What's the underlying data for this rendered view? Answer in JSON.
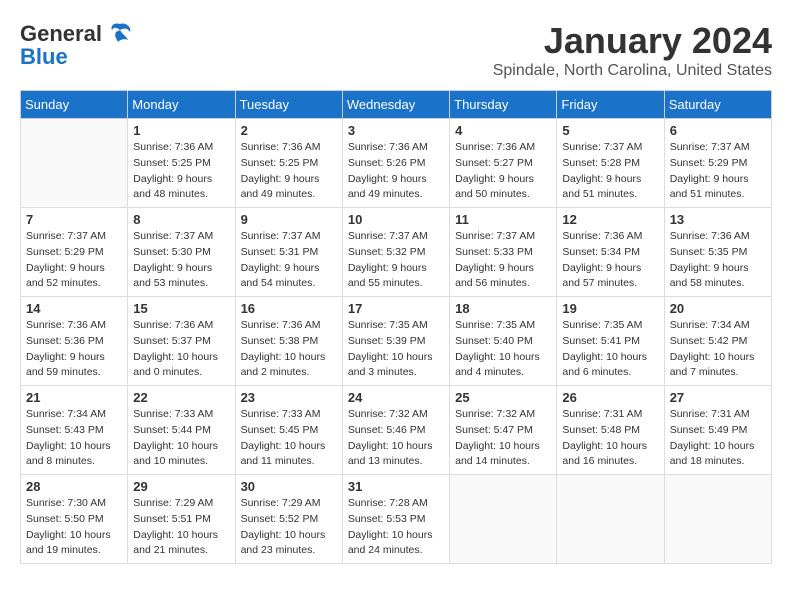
{
  "header": {
    "logo_general": "General",
    "logo_blue": "Blue",
    "month_title": "January 2024",
    "subtitle": "Spindale, North Carolina, United States"
  },
  "weekdays": [
    "Sunday",
    "Monday",
    "Tuesday",
    "Wednesday",
    "Thursday",
    "Friday",
    "Saturday"
  ],
  "weeks": [
    [
      {
        "day": null
      },
      {
        "day": 1,
        "sunrise": "7:36 AM",
        "sunset": "5:25 PM",
        "daylight": "9 hours and 48 minutes."
      },
      {
        "day": 2,
        "sunrise": "7:36 AM",
        "sunset": "5:25 PM",
        "daylight": "9 hours and 49 minutes."
      },
      {
        "day": 3,
        "sunrise": "7:36 AM",
        "sunset": "5:26 PM",
        "daylight": "9 hours and 49 minutes."
      },
      {
        "day": 4,
        "sunrise": "7:36 AM",
        "sunset": "5:27 PM",
        "daylight": "9 hours and 50 minutes."
      },
      {
        "day": 5,
        "sunrise": "7:37 AM",
        "sunset": "5:28 PM",
        "daylight": "9 hours and 51 minutes."
      },
      {
        "day": 6,
        "sunrise": "7:37 AM",
        "sunset": "5:29 PM",
        "daylight": "9 hours and 51 minutes."
      }
    ],
    [
      {
        "day": 7,
        "sunrise": "7:37 AM",
        "sunset": "5:29 PM",
        "daylight": "9 hours and 52 minutes."
      },
      {
        "day": 8,
        "sunrise": "7:37 AM",
        "sunset": "5:30 PM",
        "daylight": "9 hours and 53 minutes."
      },
      {
        "day": 9,
        "sunrise": "7:37 AM",
        "sunset": "5:31 PM",
        "daylight": "9 hours and 54 minutes."
      },
      {
        "day": 10,
        "sunrise": "7:37 AM",
        "sunset": "5:32 PM",
        "daylight": "9 hours and 55 minutes."
      },
      {
        "day": 11,
        "sunrise": "7:37 AM",
        "sunset": "5:33 PM",
        "daylight": "9 hours and 56 minutes."
      },
      {
        "day": 12,
        "sunrise": "7:36 AM",
        "sunset": "5:34 PM",
        "daylight": "9 hours and 57 minutes."
      },
      {
        "day": 13,
        "sunrise": "7:36 AM",
        "sunset": "5:35 PM",
        "daylight": "9 hours and 58 minutes."
      }
    ],
    [
      {
        "day": 14,
        "sunrise": "7:36 AM",
        "sunset": "5:36 PM",
        "daylight": "9 hours and 59 minutes."
      },
      {
        "day": 15,
        "sunrise": "7:36 AM",
        "sunset": "5:37 PM",
        "daylight": "10 hours and 0 minutes."
      },
      {
        "day": 16,
        "sunrise": "7:36 AM",
        "sunset": "5:38 PM",
        "daylight": "10 hours and 2 minutes."
      },
      {
        "day": 17,
        "sunrise": "7:35 AM",
        "sunset": "5:39 PM",
        "daylight": "10 hours and 3 minutes."
      },
      {
        "day": 18,
        "sunrise": "7:35 AM",
        "sunset": "5:40 PM",
        "daylight": "10 hours and 4 minutes."
      },
      {
        "day": 19,
        "sunrise": "7:35 AM",
        "sunset": "5:41 PM",
        "daylight": "10 hours and 6 minutes."
      },
      {
        "day": 20,
        "sunrise": "7:34 AM",
        "sunset": "5:42 PM",
        "daylight": "10 hours and 7 minutes."
      }
    ],
    [
      {
        "day": 21,
        "sunrise": "7:34 AM",
        "sunset": "5:43 PM",
        "daylight": "10 hours and 8 minutes."
      },
      {
        "day": 22,
        "sunrise": "7:33 AM",
        "sunset": "5:44 PM",
        "daylight": "10 hours and 10 minutes."
      },
      {
        "day": 23,
        "sunrise": "7:33 AM",
        "sunset": "5:45 PM",
        "daylight": "10 hours and 11 minutes."
      },
      {
        "day": 24,
        "sunrise": "7:32 AM",
        "sunset": "5:46 PM",
        "daylight": "10 hours and 13 minutes."
      },
      {
        "day": 25,
        "sunrise": "7:32 AM",
        "sunset": "5:47 PM",
        "daylight": "10 hours and 14 minutes."
      },
      {
        "day": 26,
        "sunrise": "7:31 AM",
        "sunset": "5:48 PM",
        "daylight": "10 hours and 16 minutes."
      },
      {
        "day": 27,
        "sunrise": "7:31 AM",
        "sunset": "5:49 PM",
        "daylight": "10 hours and 18 minutes."
      }
    ],
    [
      {
        "day": 28,
        "sunrise": "7:30 AM",
        "sunset": "5:50 PM",
        "daylight": "10 hours and 19 minutes."
      },
      {
        "day": 29,
        "sunrise": "7:29 AM",
        "sunset": "5:51 PM",
        "daylight": "10 hours and 21 minutes."
      },
      {
        "day": 30,
        "sunrise": "7:29 AM",
        "sunset": "5:52 PM",
        "daylight": "10 hours and 23 minutes."
      },
      {
        "day": 31,
        "sunrise": "7:28 AM",
        "sunset": "5:53 PM",
        "daylight": "10 hours and 24 minutes."
      },
      {
        "day": null
      },
      {
        "day": null
      },
      {
        "day": null
      }
    ]
  ],
  "labels": {
    "sunrise": "Sunrise:",
    "sunset": "Sunset:",
    "daylight": "Daylight:"
  }
}
